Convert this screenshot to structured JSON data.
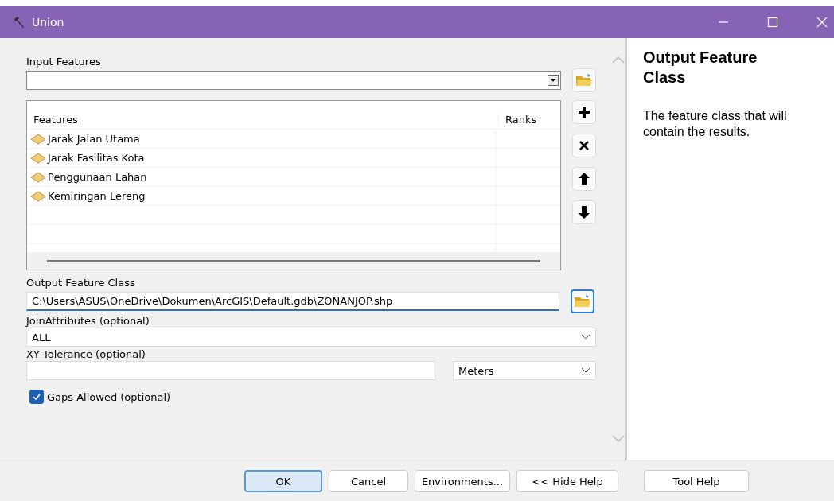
{
  "window": {
    "title": "Union"
  },
  "input_features": {
    "label": "Input Features"
  },
  "features_table": {
    "columns": [
      "Features",
      "Ranks"
    ],
    "rows": [
      {
        "name": "Jarak Jalan Utama"
      },
      {
        "name": "Jarak Fasilitas Kota"
      },
      {
        "name": "Penggunaan Lahan"
      },
      {
        "name": "Kemiringan Lereng"
      }
    ]
  },
  "output_feature_class": {
    "label": "Output Feature Class",
    "value": "C:\\Users\\ASUS\\OneDrive\\Dokumen\\ArcGIS\\Default.gdb\\ZONANJOP.shp"
  },
  "join_attributes": {
    "label": "JoinAttributes (optional)",
    "value": "ALL"
  },
  "xy_tolerance": {
    "label": "XY Tolerance (optional)",
    "unit": "Meters"
  },
  "gaps_allowed": {
    "label": "Gaps Allowed (optional)",
    "checked": true
  },
  "help": {
    "title": "Output Feature Class",
    "text": "The feature class that will contain the results."
  },
  "buttons": [
    {
      "label": "OK",
      "selected": true
    },
    {
      "label": "Cancel",
      "selected": false
    },
    {
      "label": "Environments...",
      "selected": false
    },
    {
      "label": "<< Hide Help",
      "selected": false
    },
    {
      "label": "Tool Help",
      "selected": false
    }
  ]
}
